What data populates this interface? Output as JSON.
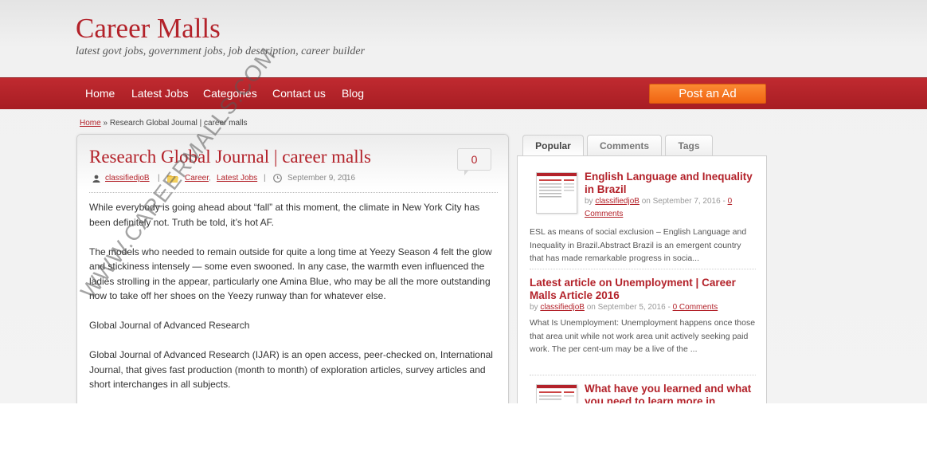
{
  "site": {
    "title": "Career Malls",
    "tagline": "latest govt jobs, government jobs, job description, career builder"
  },
  "nav": {
    "items": [
      "Home",
      "Latest Jobs",
      "Categories",
      "Contact us",
      "Blog"
    ],
    "post_ad": "Post an Ad"
  },
  "breadcrumb": {
    "home": "Home",
    "separator": "»",
    "current": "Research Global Journal | career malls"
  },
  "post": {
    "title": "Research Global Journal | career malls",
    "comment_count": "0",
    "author": "classifiedjoB",
    "categories": [
      "Career",
      "Latest Jobs"
    ],
    "date": "September 9, 2016",
    "paragraphs": [
      "While everybody is going ahead about “fall” at this moment, the climate in New York City has been definitely not. Truth be told, it’s hot AF.",
      "The models who needed to remain outside for quite a long time at Yeezy Season 4 felt the glow and stickiness intensely — some even swooned. In any case, the warmth even influenced the ladies strolling in the appear, particularly one Amina Blue, who may be all the more outstanding now to take off her shoes on the Yeezy runway than for whatever else.",
      "Global Journal of Advanced Research",
      "Global Journal of Advanced Research (IJAR) is an open access, peer-checked on, International Journal, that gives fast production (month to month) of exploration articles, survey articles and short interchanges in all subjects."
    ]
  },
  "sidebar": {
    "tabs": [
      "Popular",
      "Comments",
      "Tags"
    ],
    "items": [
      {
        "title": "English Language and Inequality in Brazil",
        "by": "by",
        "author": "classifiedjoB",
        "on": "on September 7, 2016 -",
        "comments": "0 Comments",
        "excerpt": "ESL as means of social exclusion – English Language and Inequality in Brazil.Abstract Brazil is an emergent country that has made remarkable progress in socia..."
      },
      {
        "title": "Latest article on Unemployment | Career Malls Article 2016",
        "by": "by",
        "author": "classifiedjoB",
        "on": "on September 5, 2016 -",
        "comments": "0 Comments",
        "excerpt": "What Is Unemployment: Unemployment happens once those that area unit while not work area unit actively seeking paid work. The per cent-um may be a live of the ..."
      },
      {
        "title": "What have you learned and what you need to learn more in"
      }
    ]
  },
  "watermark": "WWW.CAREERMALLS.COM",
  "colors": {
    "brand_red": "#b3222a",
    "nav_red": "#b11f26",
    "ad_orange": "#f57420"
  }
}
